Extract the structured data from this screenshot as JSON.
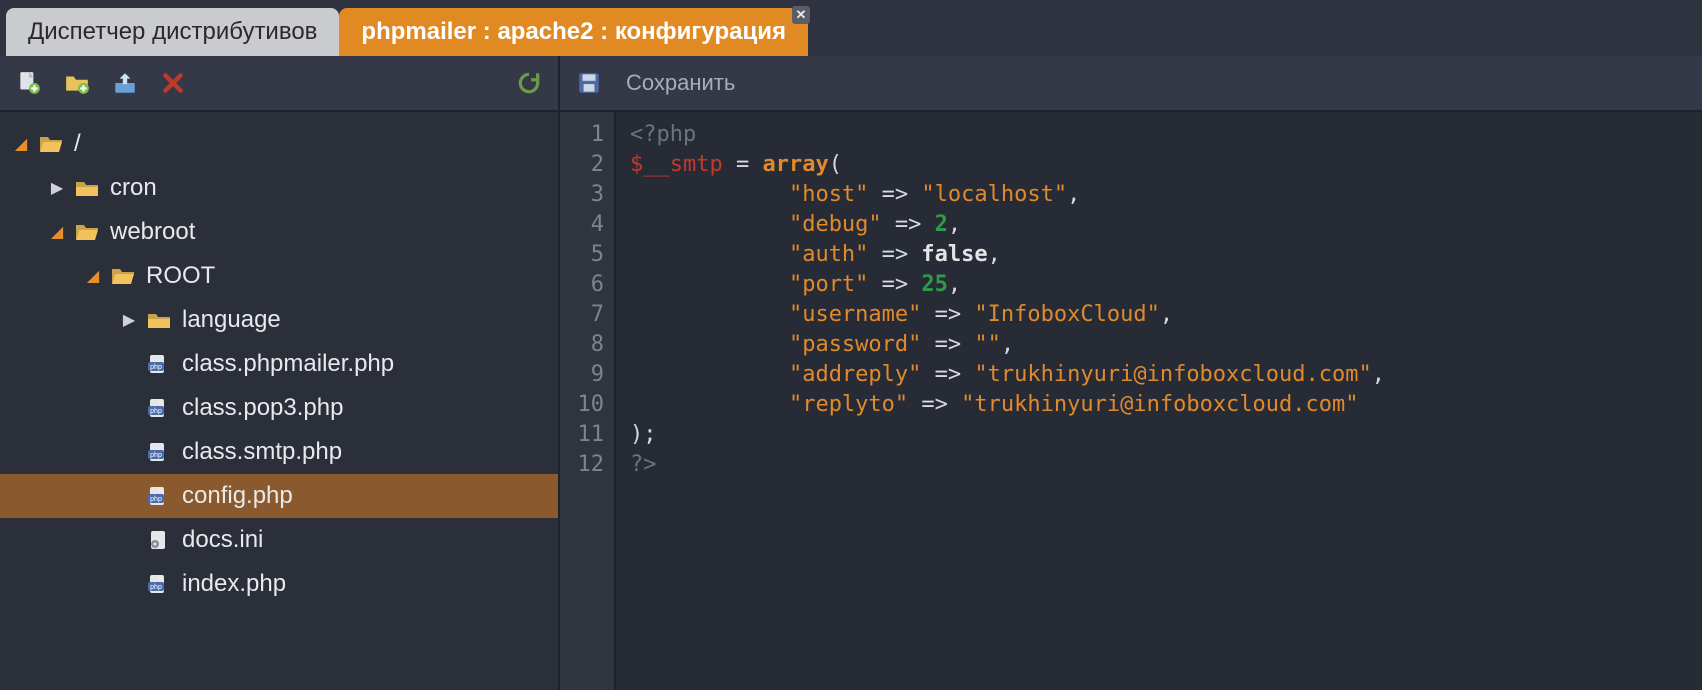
{
  "tabs": [
    {
      "label": "Диспетчер дистрибутивов",
      "active": false
    },
    {
      "label": "phpmailer : apache2 : конфигурация",
      "active": true,
      "closable": true
    }
  ],
  "sidebar_toolbar": {
    "icons": [
      "new-file-icon",
      "new-folder-icon",
      "upload-icon",
      "delete-icon",
      "refresh-icon"
    ]
  },
  "editor_toolbar": {
    "save_label": "Сохранить"
  },
  "tree": [
    {
      "depth": 0,
      "twisty": "expanded",
      "icon": "folder-open",
      "label": "/"
    },
    {
      "depth": 1,
      "twisty": "collapsed",
      "icon": "folder",
      "label": "cron"
    },
    {
      "depth": 1,
      "twisty": "expanded",
      "icon": "folder-open",
      "label": "webroot"
    },
    {
      "depth": 2,
      "twisty": "expanded",
      "icon": "folder-open",
      "label": "ROOT"
    },
    {
      "depth": 3,
      "twisty": "collapsed",
      "icon": "folder",
      "label": "language"
    },
    {
      "depth": 3,
      "twisty": "none",
      "icon": "php",
      "label": "class.phpmailer.php"
    },
    {
      "depth": 3,
      "twisty": "none",
      "icon": "php",
      "label": "class.pop3.php"
    },
    {
      "depth": 3,
      "twisty": "none",
      "icon": "php",
      "label": "class.smtp.php"
    },
    {
      "depth": 3,
      "twisty": "none",
      "icon": "php",
      "label": "config.php",
      "selected": true
    },
    {
      "depth": 3,
      "twisty": "none",
      "icon": "ini",
      "label": "docs.ini"
    },
    {
      "depth": 3,
      "twisty": "none",
      "icon": "php",
      "label": "index.php"
    }
  ],
  "code": {
    "line_count": 12,
    "lines": {
      "l1": "<?php",
      "l2a": "$__smtp",
      "l2b": " = ",
      "l2c": "array",
      "l2d": "(",
      "k_host": "\"host\"",
      "v_host": "\"localhost\"",
      "k_debug": "\"debug\"",
      "v_debug": "2",
      "k_auth": "\"auth\"",
      "v_auth": "false",
      "k_port": "\"port\"",
      "v_port": "25",
      "k_user": "\"username\"",
      "v_user": "\"InfoboxCloud\"",
      "k_pass": "\"password\"",
      "v_pass": "\"\"",
      "k_addr": "\"addreply\"",
      "v_addr": "\"trukhinyuri@infoboxcloud.com\"",
      "k_reply": "\"replyto\"",
      "v_reply": "\"trukhinyuri@infoboxcloud.com\"",
      "l11": ");",
      "l12": "?>"
    }
  }
}
